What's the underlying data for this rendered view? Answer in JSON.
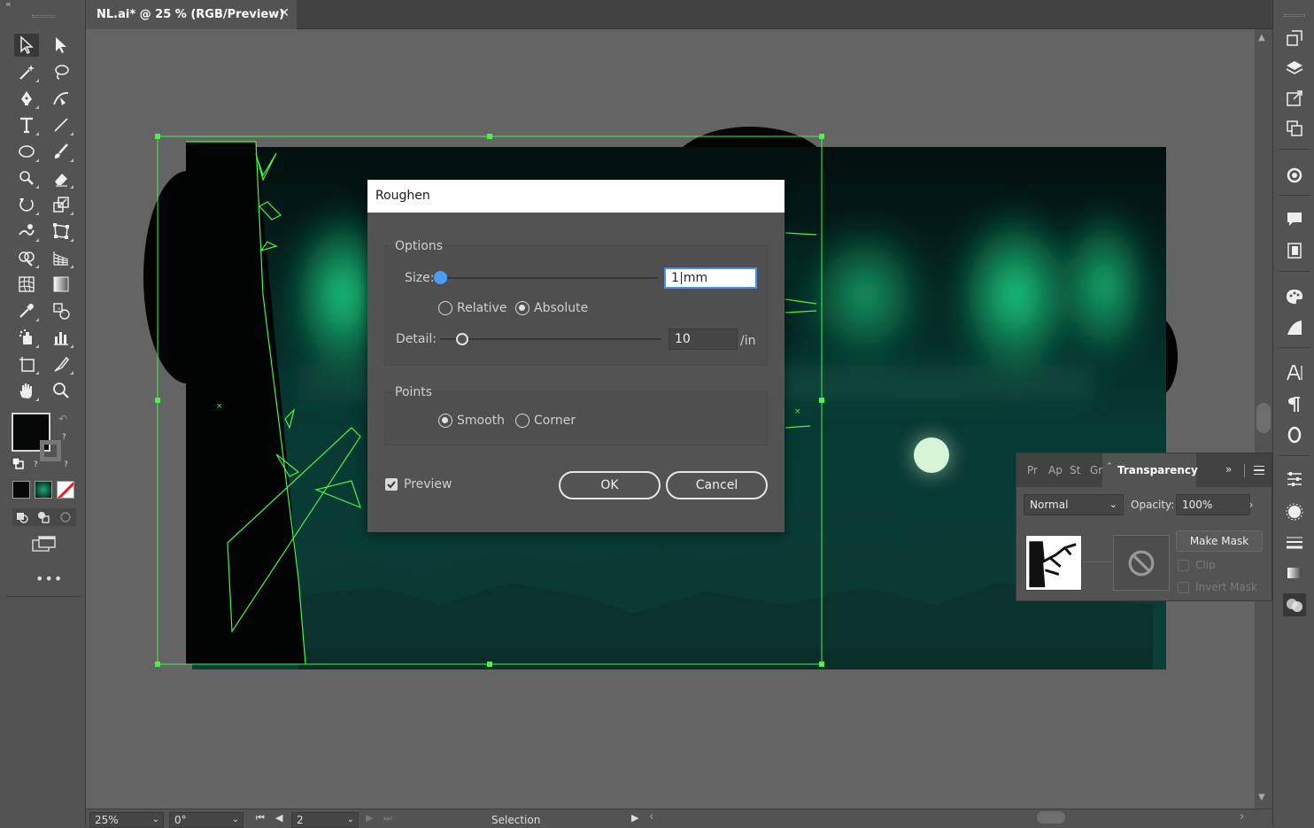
{
  "document_tab": {
    "title": "NL.ai* @ 25 % (RGB/Preview)",
    "close": "✕"
  },
  "dialog": {
    "title": "Roughen",
    "options": {
      "group_title": "Options",
      "size_label": "Size:",
      "size_value": "1",
      "size_unit": "mm",
      "size_slider": 0,
      "relative_label": "Relative",
      "absolute_label": "Absolute",
      "selected_mode": "Absolute",
      "detail_label": "Detail:",
      "detail_value": "10",
      "detail_unit": "/in",
      "detail_slider": 0.1
    },
    "points": {
      "group_title": "Points",
      "smooth_label": "Smooth",
      "corner_label": "Corner",
      "selected": "Smooth"
    },
    "preview_label": "Preview",
    "preview_checked": true,
    "ok_label": "OK",
    "cancel_label": "Cancel"
  },
  "transparency_panel": {
    "tabs": [
      "Pr",
      "Ap",
      "St",
      "Gr"
    ],
    "active_tab": "Transparency",
    "blend_mode": "Normal",
    "opacity_label": "Opacity:",
    "opacity_value": "100%",
    "make_mask_label": "Make Mask",
    "clip_label": "Clip",
    "invert_mask_label": "Invert Mask"
  },
  "status_bar": {
    "zoom": "25%",
    "rotation": "0°",
    "artboard": "2",
    "tool": "Selection"
  },
  "colors": {
    "selection": "#4cf24c",
    "aurora": "#1fe08a",
    "moon": "#d6f5d6",
    "sky": "#042321",
    "ground": "#0b3a33",
    "focus": "#4a90e2"
  }
}
